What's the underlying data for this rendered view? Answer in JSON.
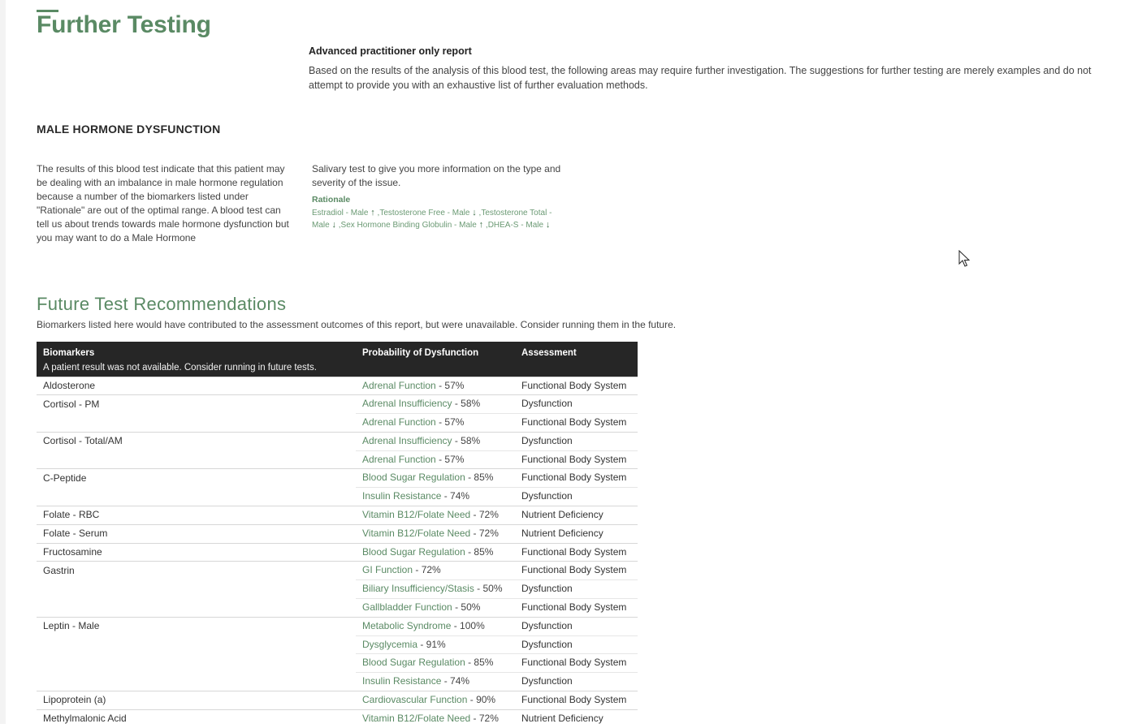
{
  "page": {
    "title": "Further Testing",
    "intro_heading": "Advanced practitioner only report",
    "intro_text": "Based on the results of the analysis of this blood test, the following areas may require further investigation. The suggestions for further testing are merely examples and do not attempt to provide you with an exhaustive list of further evaluation methods."
  },
  "section": {
    "heading": "MALE HORMONE DYSFUNCTION",
    "body": "The results of this blood test indicate that this patient may be dealing with an imbalance in male hormone regulation because a number of the biomarkers listed under \"Rationale\" are out of the optimal range. A blood test can tell us about trends towards male hormone dysfunction but you may want to do a Male Hormone",
    "right_text": "Salivary test to give you more information on the type and severity of the issue.",
    "rationale_label": "Rationale",
    "rationale": [
      {
        "name": "Estradiol - Male",
        "arrow": "↑"
      },
      {
        "name": "Testosterone Free - Male",
        "arrow": "↓"
      },
      {
        "name": "Testosterone Total - Male",
        "arrow": "↓"
      },
      {
        "name": "Sex Hormone Binding Globulin - Male",
        "arrow": "↑"
      },
      {
        "name": "DHEA-S - Male",
        "arrow": "↓"
      }
    ]
  },
  "future": {
    "title": "Future Test Recommendations",
    "subtitle": "Biomarkers listed here would have contributed to the assessment outcomes of this report, but were unavailable. Consider running them in the future.",
    "headers": {
      "biomarkers": "Biomarkers",
      "note": "A patient result was not available. Consider running in future tests.",
      "probability": "Probability of Dysfunction",
      "assessment": "Assessment"
    },
    "rows": [
      {
        "biomarker": "Aldosterone",
        "items": [
          {
            "name": "Adrenal Function",
            "pct": " - 57%",
            "assessment": "Functional Body System"
          }
        ]
      },
      {
        "biomarker": "Cortisol - PM",
        "items": [
          {
            "name": "Adrenal Insufficiency",
            "pct": " - 58%",
            "assessment": "Dysfunction"
          },
          {
            "name": "Adrenal Function",
            "pct": " - 57%",
            "assessment": "Functional Body System"
          }
        ]
      },
      {
        "biomarker": "Cortisol - Total/AM",
        "items": [
          {
            "name": "Adrenal Insufficiency",
            "pct": " - 58%",
            "assessment": "Dysfunction"
          },
          {
            "name": "Adrenal Function",
            "pct": " - 57%",
            "assessment": "Functional Body System"
          }
        ]
      },
      {
        "biomarker": "C-Peptide",
        "items": [
          {
            "name": "Blood Sugar Regulation",
            "pct": " - 85%",
            "assessment": "Functional Body System"
          },
          {
            "name": "Insulin Resistance",
            "pct": " - 74%",
            "assessment": "Dysfunction"
          }
        ]
      },
      {
        "biomarker": "Folate - RBC",
        "items": [
          {
            "name": "Vitamin B12/Folate Need",
            "pct": " - 72%",
            "assessment": "Nutrient Deficiency"
          }
        ]
      },
      {
        "biomarker": "Folate - Serum",
        "items": [
          {
            "name": "Vitamin B12/Folate Need",
            "pct": " - 72%",
            "assessment": "Nutrient Deficiency"
          }
        ]
      },
      {
        "biomarker": "Fructosamine",
        "items": [
          {
            "name": "Blood Sugar Regulation",
            "pct": " - 85%",
            "assessment": "Functional Body System"
          }
        ]
      },
      {
        "biomarker": "Gastrin",
        "items": [
          {
            "name": "GI Function",
            "pct": " - 72%",
            "assessment": "Functional Body System"
          },
          {
            "name": "Biliary Insufficiency/Stasis",
            "pct": " - 50%",
            "assessment": "Dysfunction"
          },
          {
            "name": "Gallbladder Function",
            "pct": " - 50%",
            "assessment": "Functional Body System"
          }
        ]
      },
      {
        "biomarker": "Leptin - Male",
        "items": [
          {
            "name": "Metabolic Syndrome",
            "pct": " - 100%",
            "assessment": "Dysfunction"
          },
          {
            "name": "Dysglycemia",
            "pct": " - 91%",
            "assessment": "Dysfunction"
          },
          {
            "name": "Blood Sugar Regulation",
            "pct": " - 85%",
            "assessment": "Functional Body System"
          },
          {
            "name": "Insulin Resistance",
            "pct": " - 74%",
            "assessment": "Dysfunction"
          }
        ]
      },
      {
        "biomarker": "Lipoprotein (a)",
        "items": [
          {
            "name": "Cardiovascular Function",
            "pct": " - 90%",
            "assessment": "Functional Body System"
          }
        ]
      },
      {
        "biomarker": "Methylmalonic Acid",
        "items": [
          {
            "name": "Vitamin B12/Folate Need",
            "pct": " - 72%",
            "assessment": "Nutrient Deficiency"
          }
        ]
      }
    ]
  },
  "colors": {
    "accent": "#5a8a64",
    "header_bg": "#262626"
  },
  "icons": {
    "cursor": "mouse-pointer-icon"
  }
}
